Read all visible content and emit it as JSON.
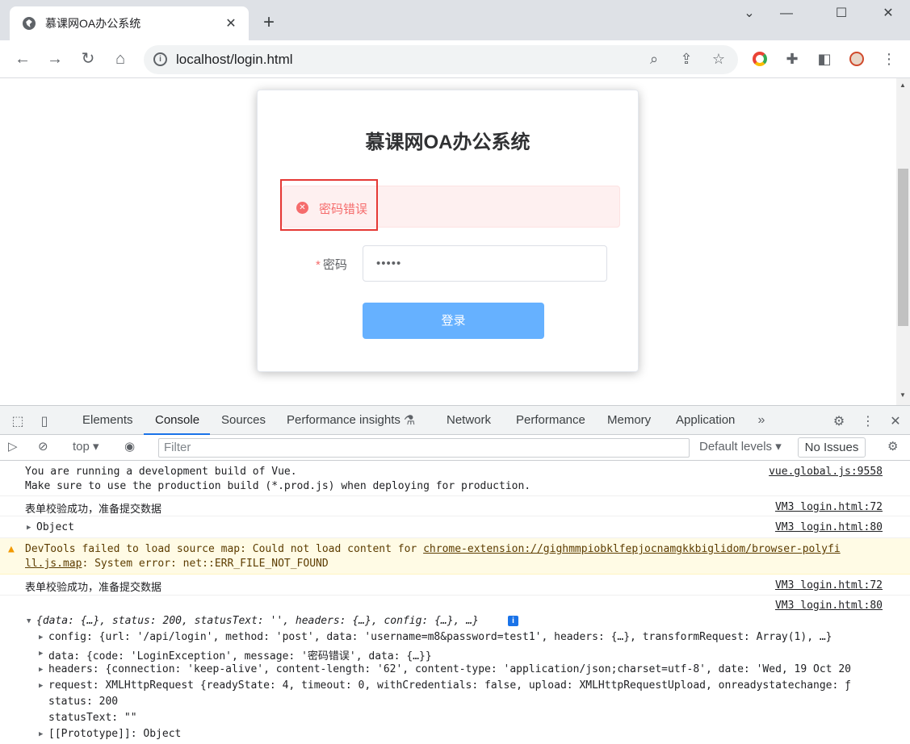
{
  "browser": {
    "tab_title": "慕课网OA办公系统",
    "tab_close": "✕",
    "new_tab": "+",
    "url": "localhost/login.html"
  },
  "page": {
    "title": "慕课网OA办公系统",
    "error_message": "密码错误",
    "password_label": "密码",
    "password_required": "*",
    "password_value": "•••••",
    "login_button": "登录"
  },
  "devtools": {
    "tabs": [
      "Elements",
      "Console",
      "Sources",
      "Performance insights",
      "Network",
      "Performance",
      "Memory",
      "Application"
    ],
    "active_tab": "Console",
    "context": "top",
    "filter_placeholder": "Filter",
    "levels": "Default levels",
    "issues": "No Issues"
  },
  "console": {
    "vue_line1": "You are running a development build of Vue.",
    "vue_line2": "Make sure to use the production build (*.prod.js) when deploying for production.",
    "vue_src": "vue.global.js:9558",
    "valid_msg": "表单校验成功，准备提交数据",
    "src72": "VM3 login.html:72",
    "object_label": "Object",
    "src80": "VM3 login.html:80",
    "warn_prefix": "DevTools failed to load source map: Could not load content for ",
    "warn_link1": "chrome-extension://gighmmpiobklfepjocnamgkkbiglidom/browser-polyfi",
    "warn_link2": "ll.js.map",
    "warn_suffix": ": System error: net::ERR_FILE_NOT_FOUND",
    "valid_msg2": "表单校验成功，准备提交数据",
    "src72b": "VM3 login.html:72",
    "src80b": "VM3 login.html:80",
    "response_summary": "{data: {…}, status: 200, statusText: '', headers: {…}, config: {…}, …}",
    "config_line": "config: {url: '/api/login', method: 'post', data: 'username=m8&password=test1', headers: {…}, transformRequest: Array(1), …}",
    "data_line": "data: {code: 'LoginException', message: '密码错误', data: {…}}",
    "headers_line": "headers: {connection: 'keep-alive', content-length: '62', content-type: 'application/json;charset=utf-8', date: 'Wed, 19 Oct 20",
    "request_line": "request: XMLHttpRequest {readyState: 4, timeout: 0, withCredentials: false, upload: XMLHttpRequestUpload, onreadystatechange: ƒ",
    "status_line": "status: 200",
    "statustext_line": "statusText: \"\"",
    "proto_line": "[[Prototype]]: Object"
  }
}
